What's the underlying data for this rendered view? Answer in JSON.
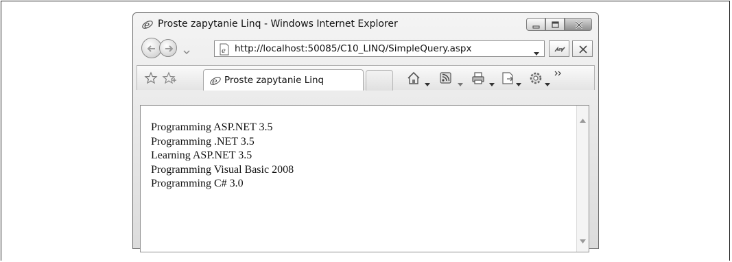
{
  "window": {
    "title": "Proste zapytanie Linq - Windows Internet Explorer"
  },
  "navigation": {
    "address_url": "http://localhost:50085/C10_LINQ/SimpleQuery.aspx"
  },
  "tab": {
    "label": "Proste zapytanie Linq"
  },
  "content": {
    "lines": [
      "Programming ASP.NET 3.5",
      "Programming .NET 3.5",
      "Learning ASP.NET 3.5",
      "Programming Visual Basic 2008",
      "Programming C# 3.0"
    ]
  },
  "icons": {
    "logo": "ie-logo-icon",
    "minimize": "minimize-icon",
    "maximize": "maximize-icon",
    "close": "close-icon",
    "back": "back-arrow-icon",
    "forward": "forward-arrow-icon",
    "refresh": "refresh-icon",
    "stop": "stop-icon",
    "favorites": "favorites-star-icon",
    "add_favorite": "add-favorite-icon",
    "home": "home-icon",
    "feeds": "feeds-icon",
    "print": "print-icon",
    "page": "page-icon",
    "tools": "tools-gear-icon",
    "more": "chevron-more-icon"
  }
}
